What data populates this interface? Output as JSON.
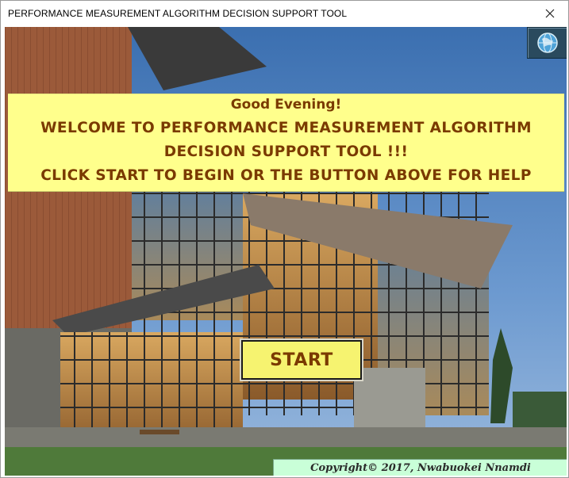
{
  "window": {
    "title": "PERFORMANCE MEASUREMENT ALGORITHM DECISION SUPPORT TOOL"
  },
  "banner": {
    "greeting": "Good Evening!",
    "line1": "WELCOME TO PERFORMANCE MEASUREMENT ALGORITHM",
    "line2": "DECISION SUPPORT TOOL !!!",
    "line3": "CLICK START TO BEGIN OR THE BUTTON  ABOVE FOR HELP"
  },
  "buttons": {
    "start_label": "START",
    "help_icon": "globe-icon",
    "close_icon": "close-icon"
  },
  "footer": {
    "copyright": "Copyright© 2017, Nwabuokei  Nnamdi"
  },
  "colors": {
    "banner_bg": "#ffff8c",
    "banner_text": "#7a3a00",
    "start_bg": "#f6f370",
    "copyright_bg": "#c9ffd8"
  }
}
